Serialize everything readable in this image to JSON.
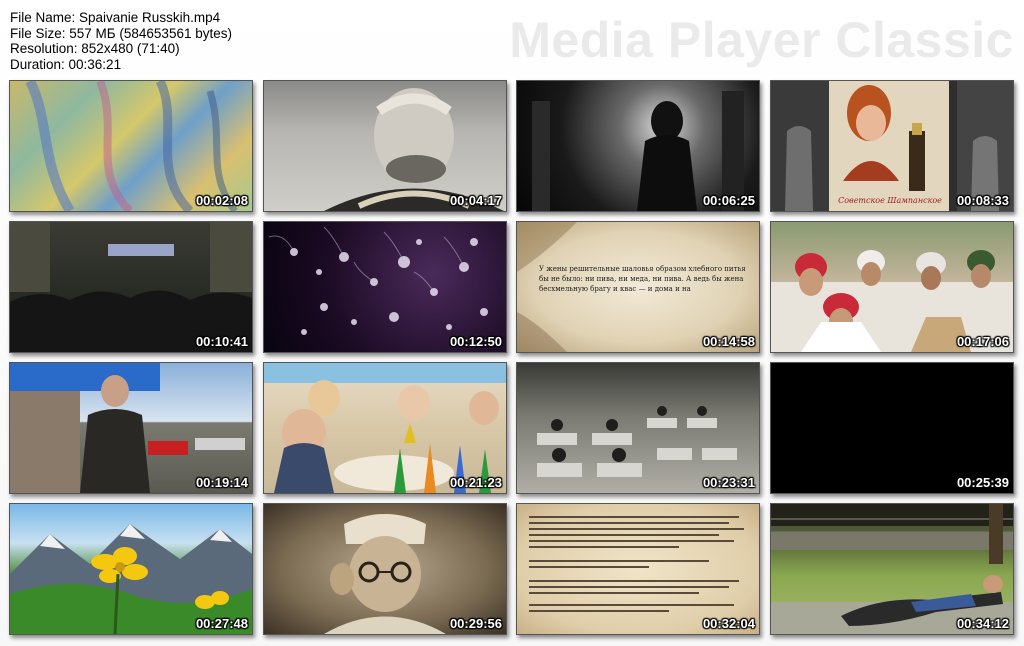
{
  "info": {
    "file_name": "File Name: Spaivanie Russkih.mp4",
    "file_size": "File Size: 557 МБ (584653561 bytes)",
    "resolution": "Resolution: 852x480 (71:40)",
    "duration": "Duration: 00:36:21"
  },
  "brand": "Media Player Classic",
  "thumbnails": [
    {
      "time": "00:02:08",
      "scene": "map-artwork"
    },
    {
      "time": "00:04:17",
      "scene": "historical-portrait"
    },
    {
      "time": "00:06:25",
      "scene": "dark-figure"
    },
    {
      "time": "00:08:33",
      "scene": "champagne-poster"
    },
    {
      "time": "00:10:41",
      "scene": "crowd-hall"
    },
    {
      "time": "00:12:50",
      "scene": "cells-microscope"
    },
    {
      "time": "00:14:58",
      "scene": "parchment-text"
    },
    {
      "time": "00:17:06",
      "scene": "arab-crowd"
    },
    {
      "time": "00:19:14",
      "scene": "man-street"
    },
    {
      "time": "00:21:23",
      "scene": "children-playing"
    },
    {
      "time": "00:23:31",
      "scene": "old-classroom"
    },
    {
      "time": "00:25:39",
      "scene": "black-frame"
    },
    {
      "time": "00:27:48",
      "scene": "yellow-flowers"
    },
    {
      "time": "00:29:56",
      "scene": "doctor-glasses"
    },
    {
      "time": "00:32:04",
      "scene": "text-page"
    },
    {
      "time": "00:34:12",
      "scene": "man-lying-grass"
    }
  ],
  "parchment_text": "У жены решительные шаловья образом хлебного питья\nбы не было: ни пива, ни меда, ни пива. А ведь бы жена\nбесхмельную брагу и квас — и дома и на",
  "champagne_label": "Советское Шампанское"
}
